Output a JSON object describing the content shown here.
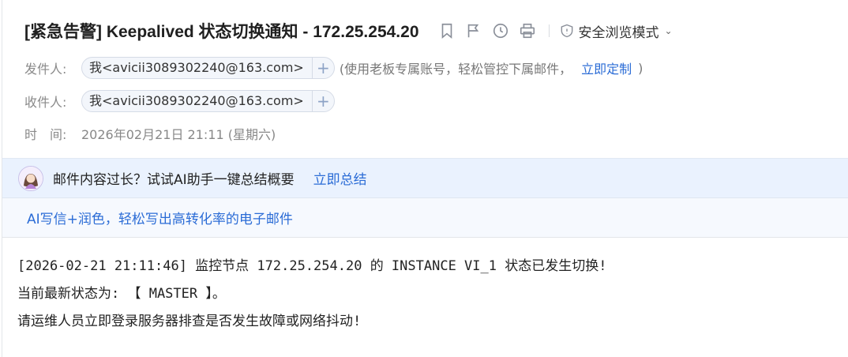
{
  "subject": "[紧急告警] Keepalived 状态切换通知 - 172.25.254.20",
  "toolbar": {
    "icons": [
      "bookmark-icon",
      "flag-icon",
      "clock-icon",
      "print-icon"
    ],
    "safe_mode_label": "安全浏览模式"
  },
  "sender": {
    "label": "发件人:",
    "address": "我<avicii3089302240@163.com>",
    "note": "(使用老板专属账号，轻松管控下属邮件，",
    "link": "立即定制",
    "close_paren": ")"
  },
  "recipient": {
    "label": "收件人:",
    "address": "我<avicii3089302240@163.com>"
  },
  "time": {
    "label": "时　间:",
    "value": "2026年02月21日 21:11 (星期六)"
  },
  "ai_summary": {
    "prompt": "邮件内容过长？试试AI助手一键总结概要",
    "link": "立即总结"
  },
  "ai_write": {
    "text": "AI写信+润色，轻松写出高转化率的电子邮件"
  },
  "body": {
    "lines": [
      "[2026-02-21 21:11:46] 监控节点 172.25.254.20 的 INSTANCE VI_1 状态已发生切换!",
      "当前最新状态为: 【 MASTER 】。",
      "请运维人员立即登录服务器排查是否发生故障或网络抖动!"
    ]
  },
  "colors": {
    "link": "#2b6cd6",
    "ai_bar_bg": "#eaf2fe",
    "chip_bg": "#f3f6fb"
  }
}
